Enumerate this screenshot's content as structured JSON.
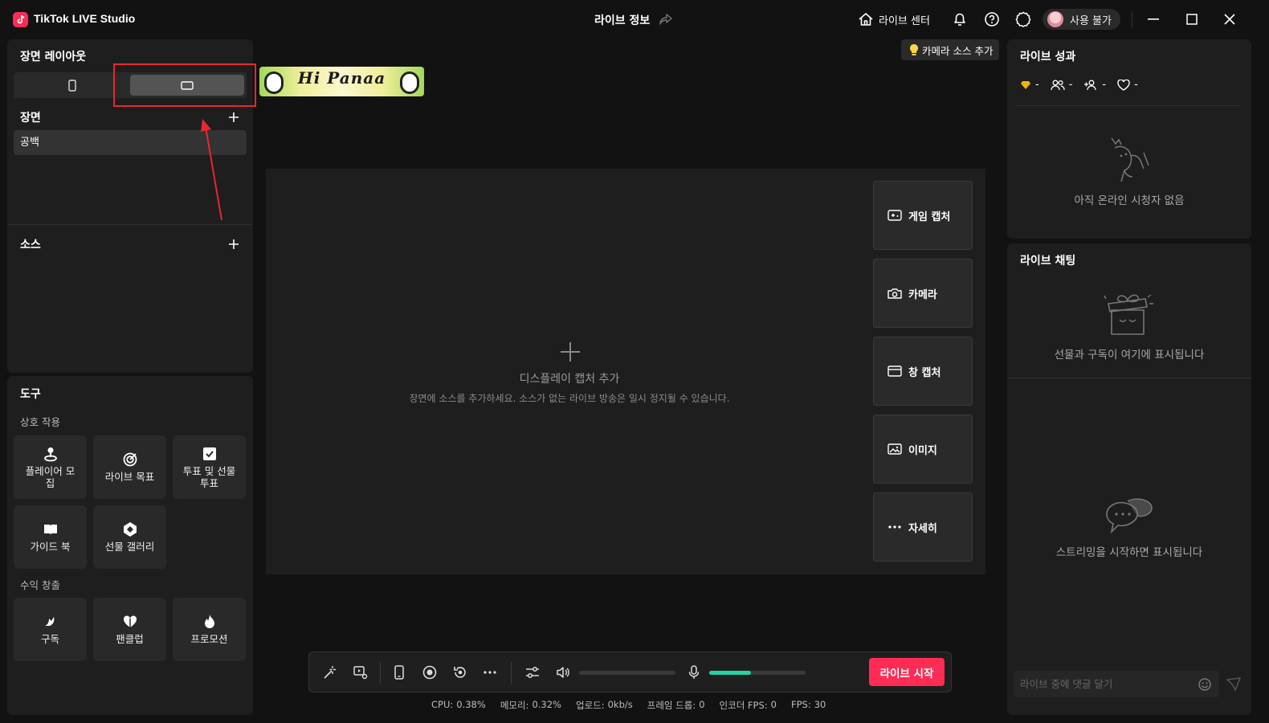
{
  "app": {
    "name": "TikTok LIVE Studio",
    "title": "라이브 정보"
  },
  "header": {
    "live_center": "라이브 센터",
    "user_status": "사용 불가"
  },
  "left": {
    "layout_title": "장면 레이아웃",
    "scenes_title": "장면",
    "scene_items": [
      "공백"
    ],
    "sources_title": "소스",
    "tools_title": "도구",
    "interaction_title": "상호 작용",
    "interaction_tools": [
      "플레이어 모집",
      "라이브 목표",
      "투표 및 선물 투표",
      "가이드 북",
      "선물 갤러리"
    ],
    "monetization_title": "수익 창출",
    "monetization_tools": [
      "구독",
      "팬클럽",
      "프로모션"
    ]
  },
  "banner": {
    "text": "Hi Panaa"
  },
  "center": {
    "camera_tip": "카메라 소스 추가",
    "empty_title": "디스플레이 캡처 추가",
    "empty_desc": "장면에 소스를 추가하세요. 소스가 없는 라이브 방송은 일시 정지될 수 있습니다.",
    "capture_buttons": [
      "게임 캡처",
      "카메라",
      "창 캡처",
      "이미지",
      "자세히"
    ]
  },
  "bottom": {
    "go_live": "라이브 시작",
    "volume_level": 0,
    "mic_level": 0.43
  },
  "status": {
    "cpu_label": "CPU:",
    "cpu": "0.38%",
    "memory_label": "메모리:",
    "memory": "0.32%",
    "upload_label": "업로드:",
    "upload": "0kb/s",
    "frame_drop_label": "프레임 드롭:",
    "frame_drop": "0",
    "encoder_fps_label": "인코더 FPS:",
    "encoder_fps": "0",
    "fps_label": "FPS:",
    "fps": "30"
  },
  "right": {
    "performance_title": "라이브 성과",
    "stats": [
      "-",
      "-",
      "-",
      "-"
    ],
    "no_viewers": "아직 온라인 시청자 없음",
    "chat_title": "라이브 채팅",
    "gifts_placeholder": "선물과 구독이 여기에 표시됩니다",
    "chat_placeholder": "스트리밍을 시작하면 표시됩니다",
    "comment_placeholder": "라이브 중에 댓글 달기"
  },
  "colors": {
    "accent": "#fe2c55",
    "mic_level": "#22d3a6",
    "callout": "#e8272e"
  },
  "icons": [
    "tiktok-logo-icon",
    "share-icon",
    "home-icon",
    "bell-icon",
    "help-icon",
    "settings-icon",
    "minimize-icon",
    "maximize-icon",
    "close-icon",
    "portrait-icon",
    "landscape-icon",
    "plus-icon",
    "gamepad-icon",
    "camera-icon",
    "window-icon",
    "image-icon",
    "more-icon",
    "send-icon",
    "emoji-icon"
  ]
}
